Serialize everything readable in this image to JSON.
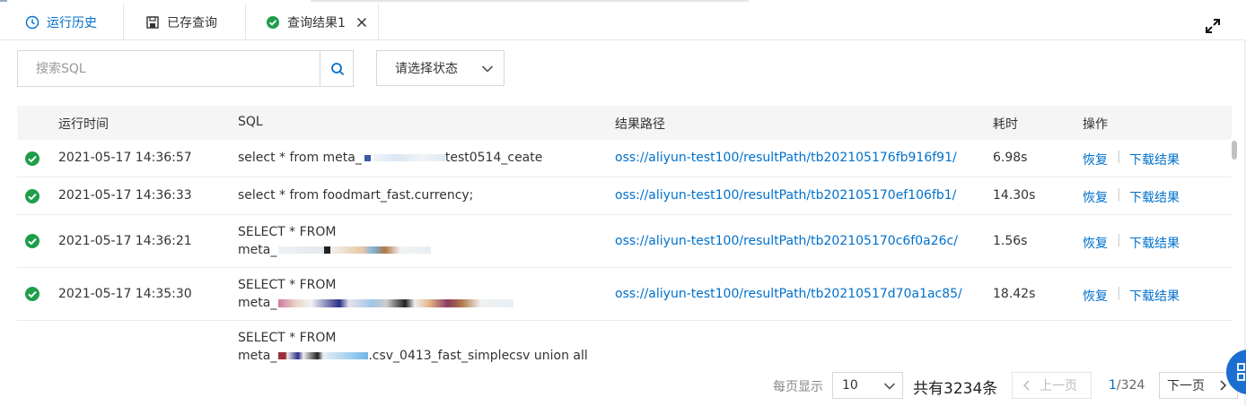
{
  "tabs": [
    {
      "label": "运行历史",
      "icon": "clock-icon",
      "active": true
    },
    {
      "label": "已存查询",
      "icon": "save-icon",
      "active": false
    },
    {
      "label": "查询结果1",
      "icon": "check-circle-icon",
      "active": false,
      "closable": true
    }
  ],
  "search": {
    "placeholder": "搜索SQL"
  },
  "status_select": {
    "label": "请选择状态"
  },
  "table": {
    "headers": {
      "time": "运行时间",
      "sql": "SQL",
      "path": "结果路径",
      "duration": "耗时",
      "ops": "操作"
    },
    "rows": [
      {
        "status": "success",
        "time": "2021-05-17 14:36:57",
        "sql_line1": "select * from meta_",
        "sql_line1_tail": "test0514_ceate",
        "path": "oss://aliyun-test100/resultPath/tb202105176fb916f91/",
        "duration": "6.98s"
      },
      {
        "status": "success",
        "time": "2021-05-17 14:36:33",
        "sql_line1": "select * from foodmart_fast.currency;",
        "path": "oss://aliyun-test100/resultPath/tb202105170ef106fb1/",
        "duration": "14.30s"
      },
      {
        "status": "success",
        "time": "2021-05-17 14:36:21",
        "sql_line1": "SELECT * FROM",
        "sql_line2": "meta_",
        "path": "oss://aliyun-test100/resultPath/tb202105170c6f0a26c/",
        "duration": "1.56s"
      },
      {
        "status": "success",
        "time": "2021-05-17 14:35:30",
        "sql_line1": "SELECT * FROM",
        "sql_line2": "meta_",
        "path": "oss://aliyun-test100/resultPath/tb20210517d70a1ac85/",
        "duration": "18.42s"
      },
      {
        "status": "",
        "time": "",
        "sql_line1": "SELECT * FROM",
        "sql_line2": "meta_",
        "sql_line2_tail": ".csv_0413_fast_simplecsv union all",
        "path": "",
        "duration": ""
      }
    ],
    "op_restore": "恢复",
    "op_download": "下载结果",
    "op_sep": "|"
  },
  "pager": {
    "per_page_label": "每页显示",
    "per_page_value": "10",
    "total": "共有3234条",
    "prev": "上一页",
    "current": "1",
    "total_pages": "/324",
    "next": "下一页"
  },
  "colors": {
    "accent": "#0070cc",
    "success": "#1e9e4a"
  }
}
